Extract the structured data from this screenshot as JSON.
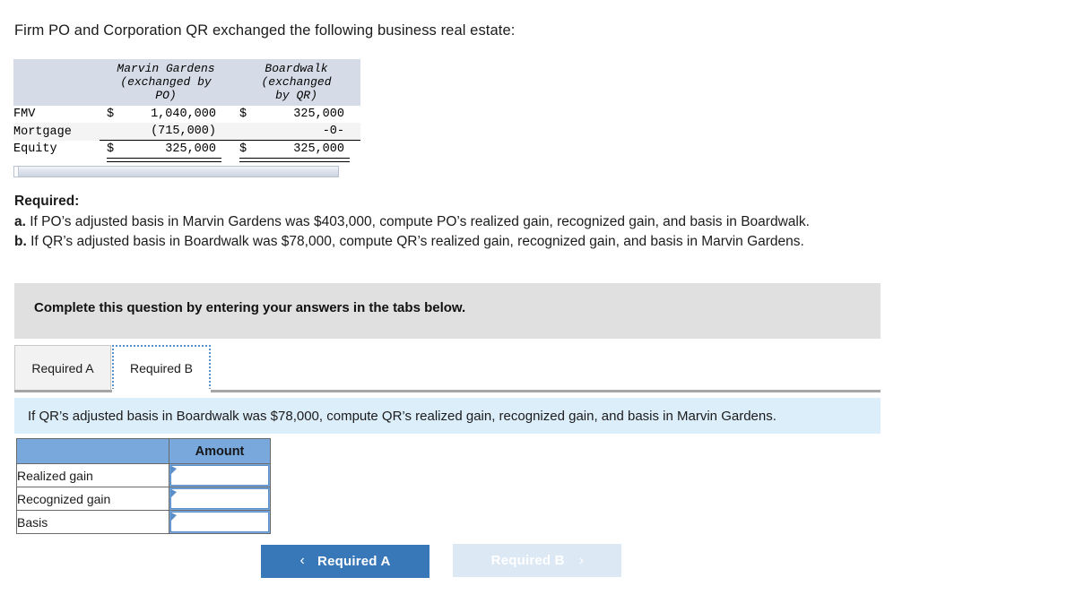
{
  "intro": "Firm PO and Corporation QR exchanged the following business real estate:",
  "fact_table": {
    "headers": [
      "",
      "Marvin Gardens (exchanged by PO)",
      "Boardwalk (exchanged by QR)"
    ],
    "header_lines": {
      "col1": [
        "Marvin Gardens",
        "(exchanged by",
        "PO)"
      ],
      "col2": [
        "Boardwalk",
        "(exchanged",
        "by QR)"
      ]
    },
    "rows": [
      {
        "label": "FMV",
        "c1_sym": "$",
        "c1_val": "1,040,000",
        "c2_sym": "$",
        "c2_val": "325,000"
      },
      {
        "label": "Mortgage",
        "c1_sym": "",
        "c1_val": "(715,000)",
        "c2_sym": "",
        "c2_val": "-0-"
      },
      {
        "label": "Equity",
        "c1_sym": "$",
        "c1_val": "325,000",
        "c2_sym": "$",
        "c2_val": "325,000"
      }
    ]
  },
  "required": {
    "title": "Required:",
    "item_a_marker": "a.",
    "item_a": "If PO’s adjusted basis in Marvin Gardens was $403,000, compute PO’s realized gain, recognized gain, and basis in Boardwalk.",
    "item_b_marker": "b.",
    "item_b": "If QR’s adjusted basis in Boardwalk was $78,000, compute QR’s realized gain, recognized gain, and basis in Marvin Gardens."
  },
  "banner": {
    "text": "Complete this question by entering your answers in the tabs below."
  },
  "tabs": [
    {
      "label": "Required A",
      "active": false
    },
    {
      "label": "Required B",
      "active": true
    }
  ],
  "question_strip": {
    "text": "If QR’s adjusted basis in Boardwalk was $78,000, compute QR’s realized gain, recognized gain, and basis in Marvin Gardens."
  },
  "answer_table": {
    "col_headers": [
      "",
      "Amount"
    ],
    "rows": [
      {
        "label": "Realized gain",
        "value": ""
      },
      {
        "label": "Recognized gain",
        "value": ""
      },
      {
        "label": "Basis",
        "value": ""
      }
    ]
  },
  "nav": {
    "prev_label": "Required A",
    "prev_chevron": "‹",
    "next_label": "Required B",
    "next_chevron": "›"
  },
  "colors": {
    "fact_header_bg": "#d6dce7",
    "banner_bg": "#e0e0e0",
    "question_strip_bg": "#ddeefb",
    "table_header_blue": "#79a8dd",
    "button_active": "#3878b8",
    "button_disabled": "#dde8f5",
    "focus_border": "#5b8fc9"
  }
}
